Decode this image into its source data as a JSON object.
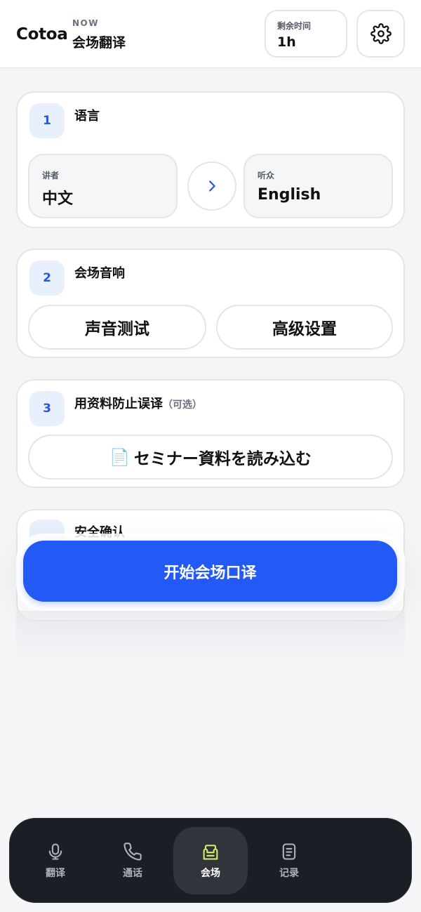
{
  "header": {
    "brand": "Cotoa",
    "now_label": "NOW",
    "mode_title": "会场翻译",
    "time_label": "剩余时间",
    "time_value": "1h",
    "settings_icon": "gear-icon"
  },
  "steps": {
    "language": {
      "number": "1",
      "title": "语言",
      "speaker_label": "讲者",
      "speaker_value": "中文",
      "audience_label": "听众",
      "audience_value": "English",
      "swap_icon": "chevron-right-icon"
    },
    "audio": {
      "number": "2",
      "title": "会场音响",
      "sound_test": "声音测试",
      "advanced": "高级设置"
    },
    "materials": {
      "number": "3",
      "title": "用资料防止误译",
      "optional": "（可选）",
      "load_icon": "📄",
      "load_button": "セミナー資料を読み込む"
    },
    "safety": {
      "title": "安全确认"
    }
  },
  "start_button": "开始会场口译",
  "colors": {
    "accent": "#2359f5",
    "badge_bg": "#e8effd",
    "badge_text": "#2b57d8",
    "nav_bg": "#1c1e26",
    "nav_active_icon": "#d4f06a"
  },
  "nav": {
    "items": [
      {
        "label": "翻译",
        "icon": "microphone-icon"
      },
      {
        "label": "通话",
        "icon": "phone-icon"
      },
      {
        "label": "会场",
        "icon": "venue-icon"
      },
      {
        "label": "记录",
        "icon": "document-list-icon"
      }
    ],
    "active_index": 2
  }
}
